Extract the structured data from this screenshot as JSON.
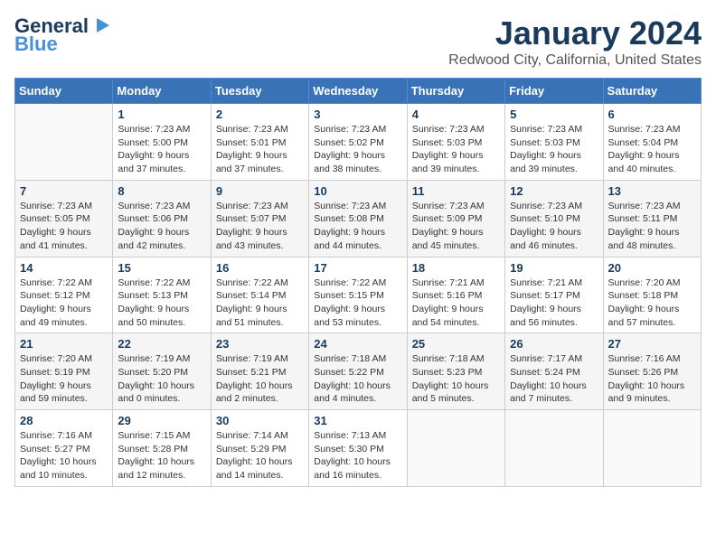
{
  "header": {
    "logo_general": "General",
    "logo_blue": "Blue",
    "month_year": "January 2024",
    "location": "Redwood City, California, United States"
  },
  "days_of_week": [
    "Sunday",
    "Monday",
    "Tuesday",
    "Wednesday",
    "Thursday",
    "Friday",
    "Saturday"
  ],
  "weeks": [
    [
      {
        "day": "",
        "info": ""
      },
      {
        "day": "1",
        "info": "Sunrise: 7:23 AM\nSunset: 5:00 PM\nDaylight: 9 hours\nand 37 minutes."
      },
      {
        "day": "2",
        "info": "Sunrise: 7:23 AM\nSunset: 5:01 PM\nDaylight: 9 hours\nand 37 minutes."
      },
      {
        "day": "3",
        "info": "Sunrise: 7:23 AM\nSunset: 5:02 PM\nDaylight: 9 hours\nand 38 minutes."
      },
      {
        "day": "4",
        "info": "Sunrise: 7:23 AM\nSunset: 5:03 PM\nDaylight: 9 hours\nand 39 minutes."
      },
      {
        "day": "5",
        "info": "Sunrise: 7:23 AM\nSunset: 5:03 PM\nDaylight: 9 hours\nand 39 minutes."
      },
      {
        "day": "6",
        "info": "Sunrise: 7:23 AM\nSunset: 5:04 PM\nDaylight: 9 hours\nand 40 minutes."
      }
    ],
    [
      {
        "day": "7",
        "info": "Sunrise: 7:23 AM\nSunset: 5:05 PM\nDaylight: 9 hours\nand 41 minutes."
      },
      {
        "day": "8",
        "info": "Sunrise: 7:23 AM\nSunset: 5:06 PM\nDaylight: 9 hours\nand 42 minutes."
      },
      {
        "day": "9",
        "info": "Sunrise: 7:23 AM\nSunset: 5:07 PM\nDaylight: 9 hours\nand 43 minutes."
      },
      {
        "day": "10",
        "info": "Sunrise: 7:23 AM\nSunset: 5:08 PM\nDaylight: 9 hours\nand 44 minutes."
      },
      {
        "day": "11",
        "info": "Sunrise: 7:23 AM\nSunset: 5:09 PM\nDaylight: 9 hours\nand 45 minutes."
      },
      {
        "day": "12",
        "info": "Sunrise: 7:23 AM\nSunset: 5:10 PM\nDaylight: 9 hours\nand 46 minutes."
      },
      {
        "day": "13",
        "info": "Sunrise: 7:23 AM\nSunset: 5:11 PM\nDaylight: 9 hours\nand 48 minutes."
      }
    ],
    [
      {
        "day": "14",
        "info": "Sunrise: 7:22 AM\nSunset: 5:12 PM\nDaylight: 9 hours\nand 49 minutes."
      },
      {
        "day": "15",
        "info": "Sunrise: 7:22 AM\nSunset: 5:13 PM\nDaylight: 9 hours\nand 50 minutes."
      },
      {
        "day": "16",
        "info": "Sunrise: 7:22 AM\nSunset: 5:14 PM\nDaylight: 9 hours\nand 51 minutes."
      },
      {
        "day": "17",
        "info": "Sunrise: 7:22 AM\nSunset: 5:15 PM\nDaylight: 9 hours\nand 53 minutes."
      },
      {
        "day": "18",
        "info": "Sunrise: 7:21 AM\nSunset: 5:16 PM\nDaylight: 9 hours\nand 54 minutes."
      },
      {
        "day": "19",
        "info": "Sunrise: 7:21 AM\nSunset: 5:17 PM\nDaylight: 9 hours\nand 56 minutes."
      },
      {
        "day": "20",
        "info": "Sunrise: 7:20 AM\nSunset: 5:18 PM\nDaylight: 9 hours\nand 57 minutes."
      }
    ],
    [
      {
        "day": "21",
        "info": "Sunrise: 7:20 AM\nSunset: 5:19 PM\nDaylight: 9 hours\nand 59 minutes."
      },
      {
        "day": "22",
        "info": "Sunrise: 7:19 AM\nSunset: 5:20 PM\nDaylight: 10 hours\nand 0 minutes."
      },
      {
        "day": "23",
        "info": "Sunrise: 7:19 AM\nSunset: 5:21 PM\nDaylight: 10 hours\nand 2 minutes."
      },
      {
        "day": "24",
        "info": "Sunrise: 7:18 AM\nSunset: 5:22 PM\nDaylight: 10 hours\nand 4 minutes."
      },
      {
        "day": "25",
        "info": "Sunrise: 7:18 AM\nSunset: 5:23 PM\nDaylight: 10 hours\nand 5 minutes."
      },
      {
        "day": "26",
        "info": "Sunrise: 7:17 AM\nSunset: 5:24 PM\nDaylight: 10 hours\nand 7 minutes."
      },
      {
        "day": "27",
        "info": "Sunrise: 7:16 AM\nSunset: 5:26 PM\nDaylight: 10 hours\nand 9 minutes."
      }
    ],
    [
      {
        "day": "28",
        "info": "Sunrise: 7:16 AM\nSunset: 5:27 PM\nDaylight: 10 hours\nand 10 minutes."
      },
      {
        "day": "29",
        "info": "Sunrise: 7:15 AM\nSunset: 5:28 PM\nDaylight: 10 hours\nand 12 minutes."
      },
      {
        "day": "30",
        "info": "Sunrise: 7:14 AM\nSunset: 5:29 PM\nDaylight: 10 hours\nand 14 minutes."
      },
      {
        "day": "31",
        "info": "Sunrise: 7:13 AM\nSunset: 5:30 PM\nDaylight: 10 hours\nand 16 minutes."
      },
      {
        "day": "",
        "info": ""
      },
      {
        "day": "",
        "info": ""
      },
      {
        "day": "",
        "info": ""
      }
    ]
  ]
}
